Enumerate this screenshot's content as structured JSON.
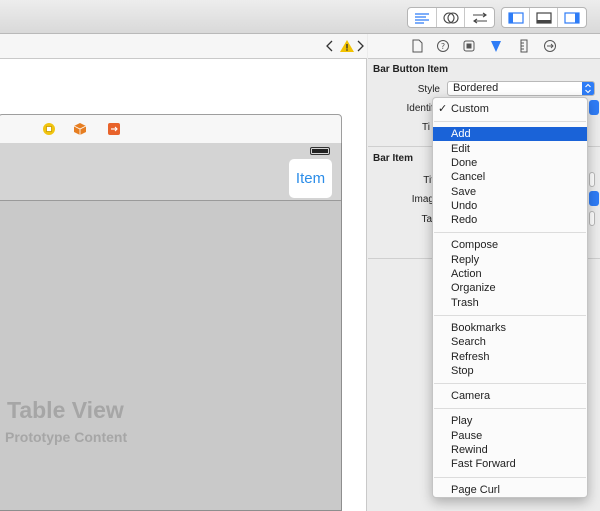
{
  "toolbar": {
    "group1": [
      "standard-editor-icon",
      "assistant-editor-icon",
      "version-editor-icon"
    ],
    "group2": [
      "navigator-toggle-icon",
      "debug-area-toggle-icon",
      "utilities-toggle-icon"
    ]
  },
  "scene": {
    "nav_item_label": "Item",
    "table_view_title": "Table View",
    "table_view_subtitle": "Prototype Content"
  },
  "inspector": {
    "section_bar_button_item": "Bar Button Item",
    "style_label": "Style",
    "style_value": "Bordered",
    "identifier_label": "Identifi",
    "tint_label": "Ti",
    "section_bar_item": "Bar Item",
    "title_label": "Tit",
    "image_label": "Imag",
    "tag_label": "Ta"
  },
  "menu": {
    "checked": "✓",
    "groups": [
      [
        "Custom"
      ],
      [
        "Add",
        "Edit",
        "Done",
        "Cancel",
        "Save",
        "Undo",
        "Redo"
      ],
      [
        "Compose",
        "Reply",
        "Action",
        "Organize",
        "Trash"
      ],
      [
        "Bookmarks",
        "Search",
        "Refresh",
        "Stop"
      ],
      [
        "Camera"
      ],
      [
        "Play",
        "Pause",
        "Rewind",
        "Fast Forward"
      ],
      [
        "Page Curl"
      ]
    ],
    "selected": "Add"
  },
  "colors": {
    "accent": "#1a63d8",
    "item_blue": "#2c8de8",
    "warning": "#f2c200",
    "dock_yellow": "#f1c40f",
    "dock_orange": "#e67e22"
  }
}
